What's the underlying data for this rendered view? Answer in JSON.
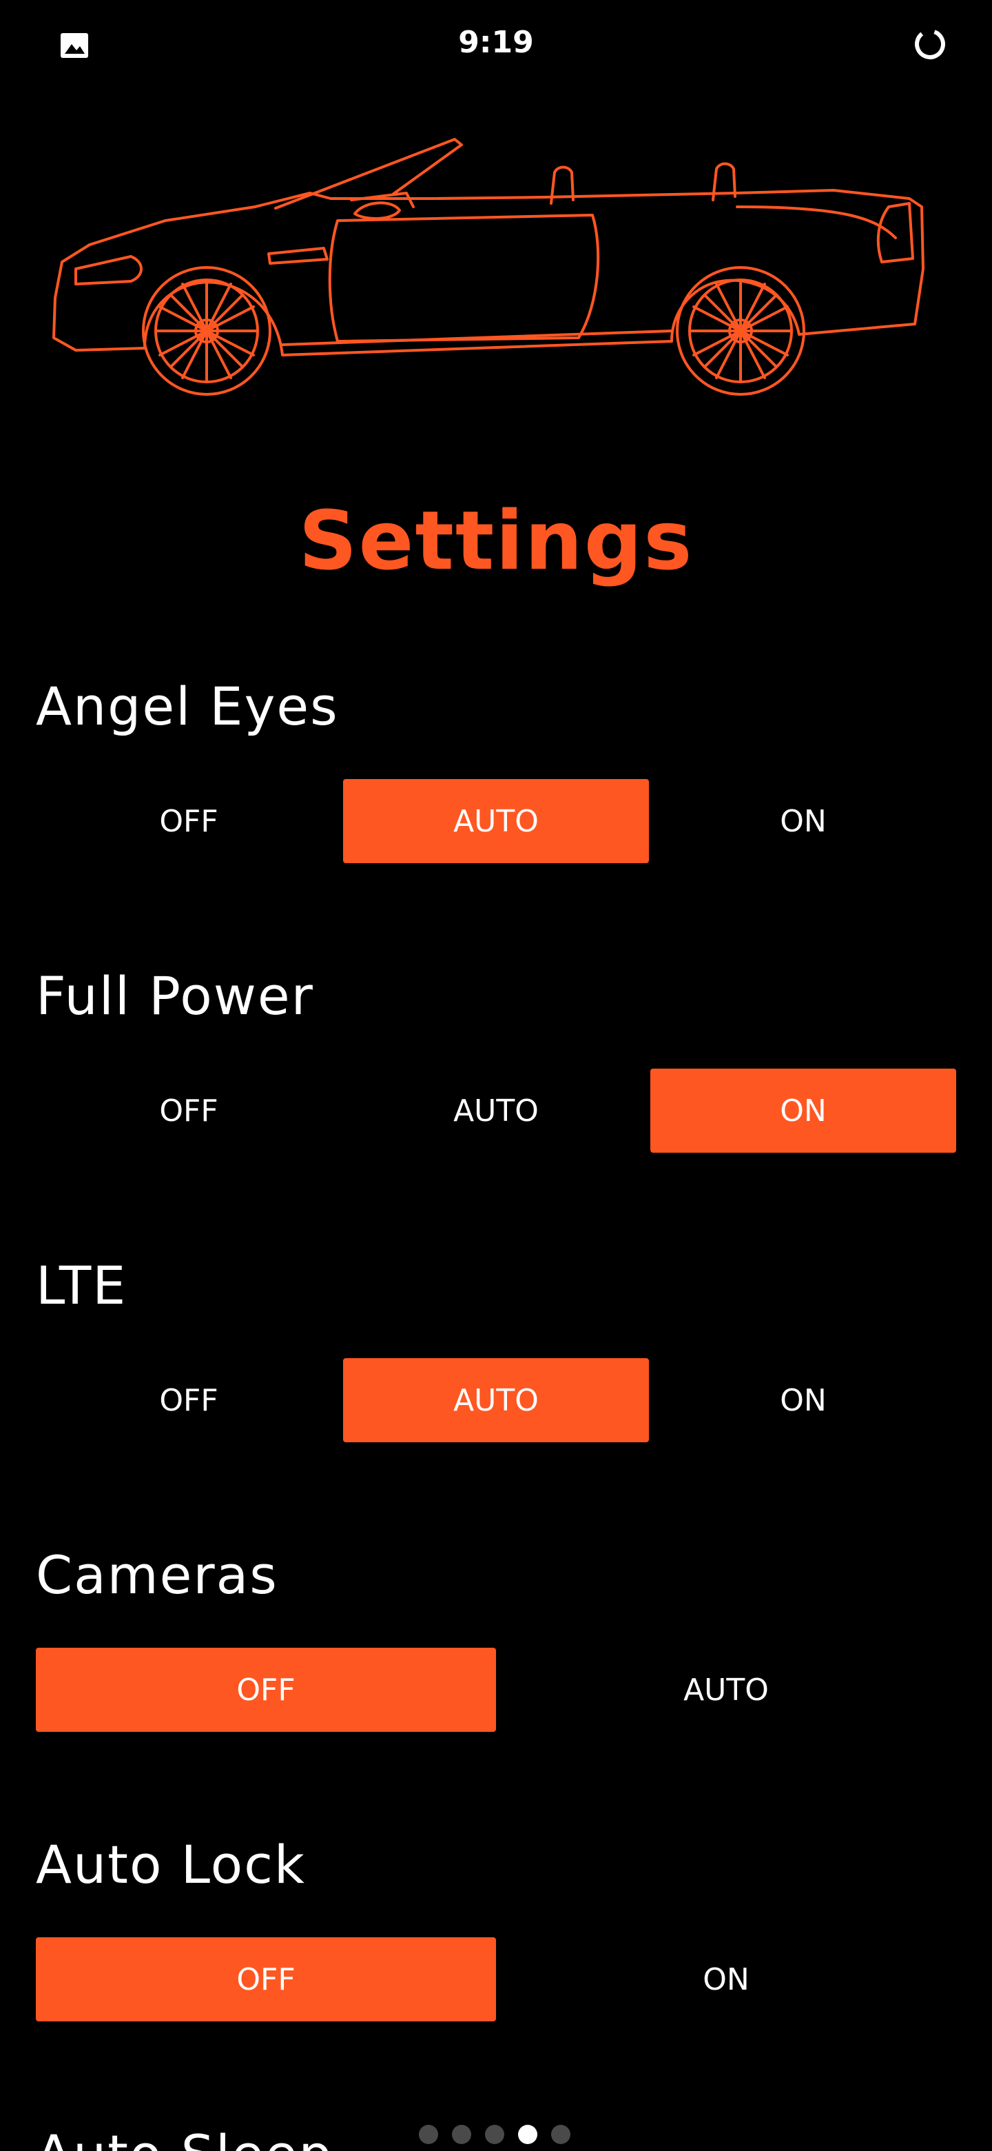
{
  "status_bar": {
    "time": "9:19",
    "left_icon": "gallery-icon",
    "right_icon": "loading-ring-icon"
  },
  "hero_image": "convertible-car-outline",
  "title": "Settings",
  "colors": {
    "accent": "#ff5722",
    "background": "#000000",
    "text": "#ffffff",
    "dot_inactive": "#4a4a4a"
  },
  "settings": [
    {
      "label": "Angel Eyes",
      "options": [
        "OFF",
        "AUTO",
        "ON"
      ],
      "selected": "AUTO"
    },
    {
      "label": "Full Power",
      "options": [
        "OFF",
        "AUTO",
        "ON"
      ],
      "selected": "ON"
    },
    {
      "label": "LTE",
      "options": [
        "OFF",
        "AUTO",
        "ON"
      ],
      "selected": "AUTO"
    },
    {
      "label": "Cameras",
      "options": [
        "OFF",
        "AUTO"
      ],
      "selected": "OFF"
    },
    {
      "label": "Auto Lock",
      "options": [
        "OFF",
        "ON"
      ],
      "selected": "OFF"
    },
    {
      "label": "Auto Sleep",
      "options": [],
      "selected": ""
    }
  ],
  "page_indicator": {
    "count": 5,
    "current": 4
  }
}
